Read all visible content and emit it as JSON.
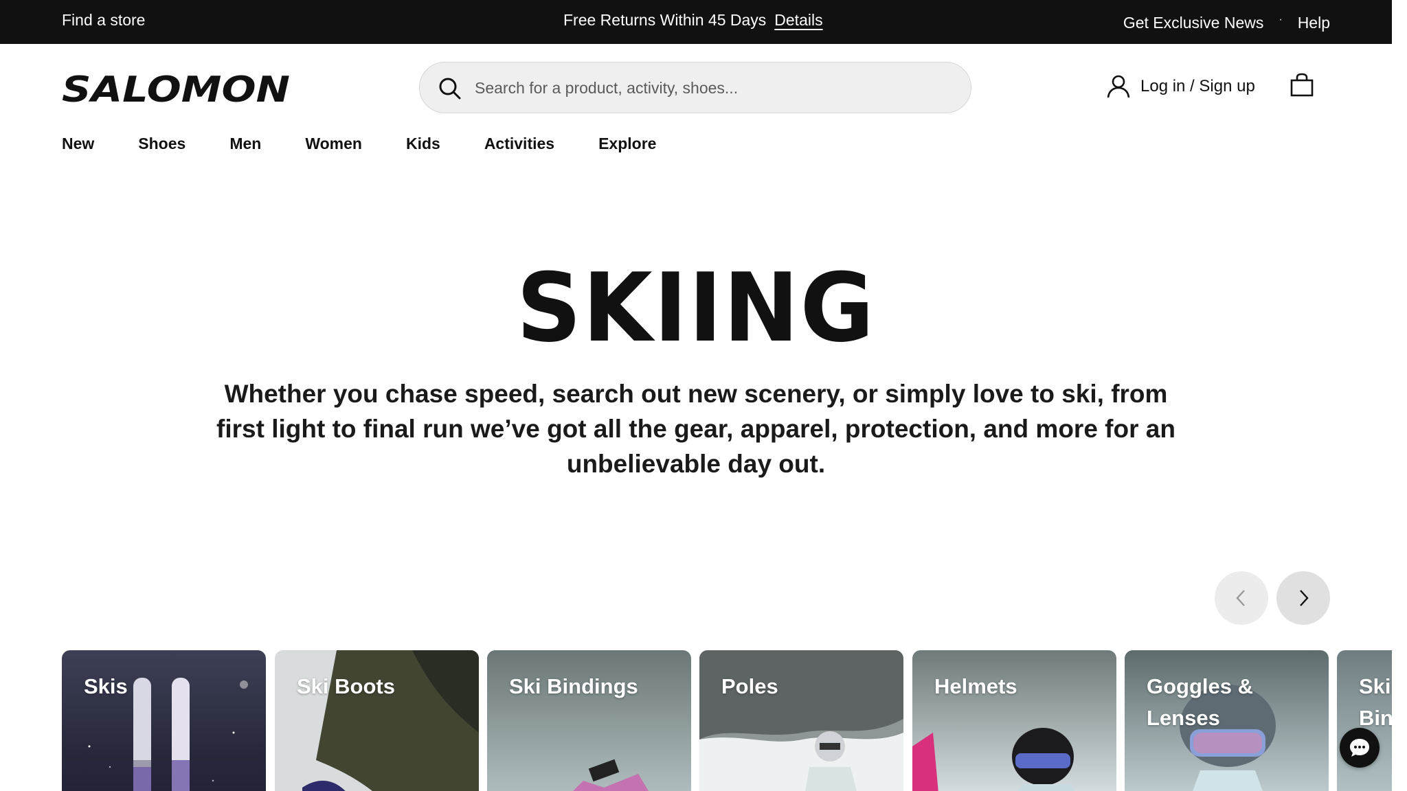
{
  "topbar": {
    "find_store": "Find a store",
    "promo_text": "Free Returns Within 45 Days",
    "promo_link": "Details",
    "news": "Get Exclusive News",
    "separator": "·",
    "help": "Help"
  },
  "header": {
    "logo_text": "SALOMON",
    "search_placeholder": "Search for a product, activity, shoes...",
    "account_label": "Log in / Sign up"
  },
  "nav": {
    "items": [
      "New",
      "Shoes",
      "Men",
      "Women",
      "Kids",
      "Activities",
      "Explore"
    ]
  },
  "hero": {
    "title": "SKIING",
    "description": "Whether you chase speed, search out new scenery, or simply love to ski, from first light to final run we’ve got all the gear, apparel, protection, and more for an unbelievable day out."
  },
  "categories": [
    {
      "label": "Skis"
    },
    {
      "label": "Ski Boots"
    },
    {
      "label": "Ski Bindings"
    },
    {
      "label": "Poles"
    },
    {
      "label": "Helmets"
    },
    {
      "label": "Goggles & Lenses"
    },
    {
      "label": "Ski Skins Tra Bin"
    }
  ],
  "colors": {
    "topbar_bg": "#111111",
    "accent": "#111111",
    "search_bg": "#efefef"
  },
  "icons": {
    "search": "search-icon",
    "user": "user-icon",
    "cart": "shopping-bag-icon",
    "prev": "chevron-left-icon",
    "next": "chevron-right-icon",
    "chat": "chat-icon"
  }
}
